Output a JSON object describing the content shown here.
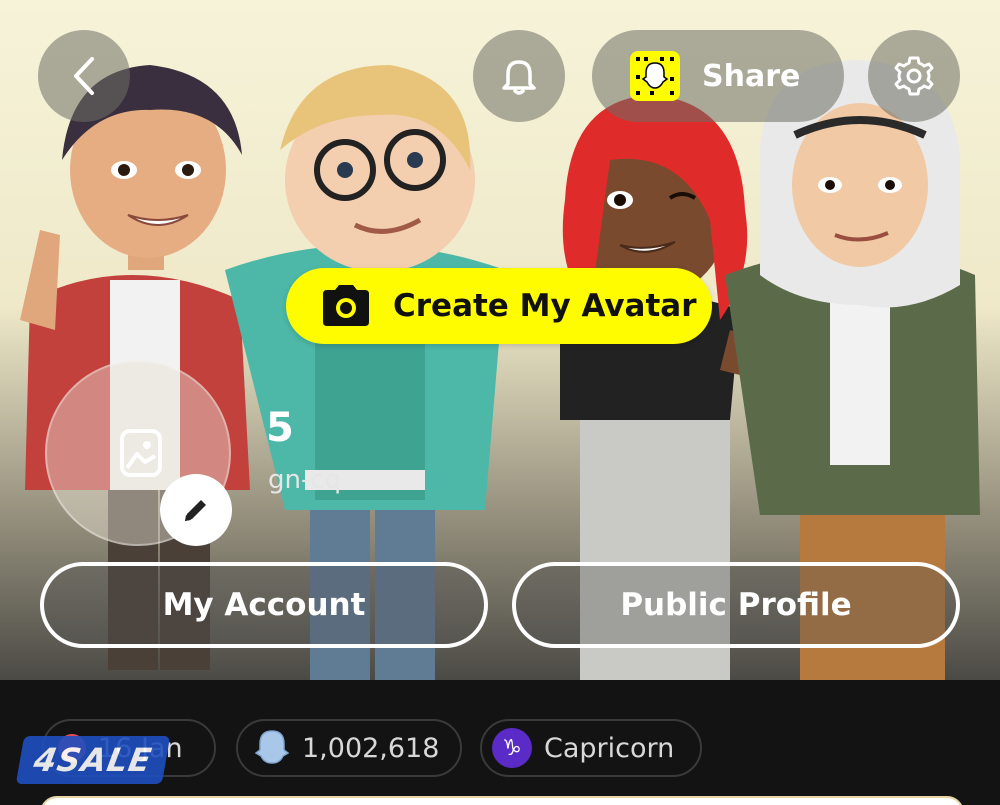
{
  "header": {
    "back_icon": "chevron-left-icon",
    "notification_icon": "bell-icon",
    "share_label": "Share",
    "settings_icon": "gear-icon"
  },
  "create_avatar": {
    "label": "Create My Avatar",
    "icon": "camera-icon"
  },
  "profile": {
    "name_partial": "5",
    "username_partial": "gn-cq",
    "photo_icon": "image-icon",
    "edit_icon": "pencil-icon"
  },
  "buttons": {
    "my_account": "My Account",
    "public_profile": "Public Profile"
  },
  "chips": [
    {
      "label": "16 Jan",
      "icon": "birthday-icon"
    },
    {
      "label": "1,002,618",
      "icon": "ghost-score-icon"
    },
    {
      "label": "Capricorn",
      "icon": "capricorn-icon"
    }
  ],
  "watermark": {
    "label": "4SALE"
  },
  "colors": {
    "snap_yellow": "#fffc00",
    "zodiac_purple": "#5b2bc8"
  }
}
